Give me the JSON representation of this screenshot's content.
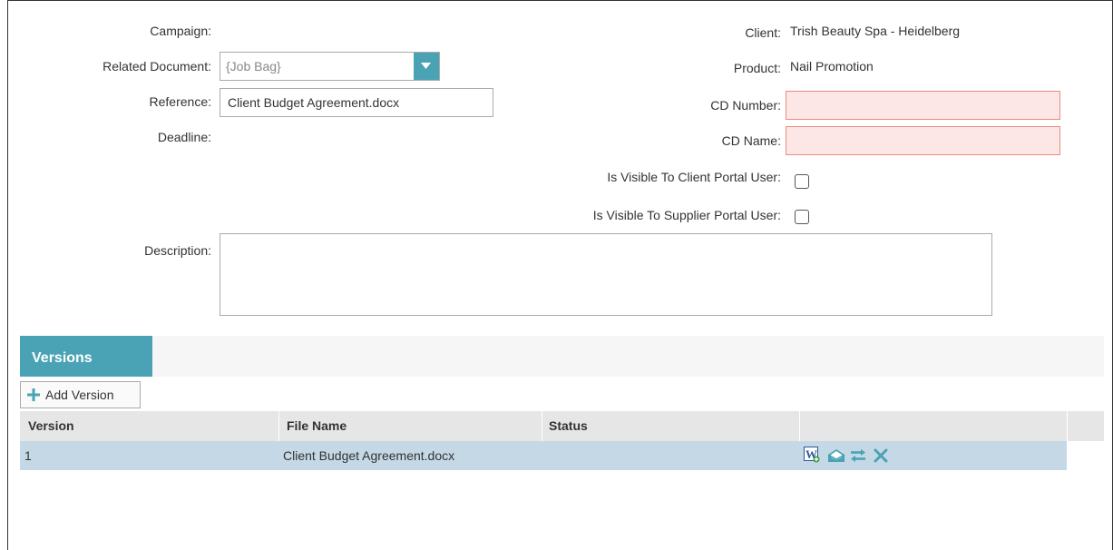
{
  "form": {
    "campaign_label": "Campaign:",
    "related_document_label": "Related Document:",
    "related_document_value": "{Job Bag}",
    "reference_label": "Reference:",
    "reference_value": "Client Budget Agreement.docx",
    "deadline_label": "Deadline:",
    "description_label": "Description:",
    "description_value": "",
    "client_label": "Client:",
    "client_value": "Trish Beauty Spa - Heidelberg",
    "product_label": "Product:",
    "product_value": "Nail Promotion",
    "cd_number_label": "CD Number:",
    "cd_number_value": "",
    "cd_name_label": "CD Name:",
    "cd_name_value": "",
    "visible_client_label": "Is Visible To Client Portal User:",
    "visible_client_checked": false,
    "visible_supplier_label": "Is Visible To Supplier Portal User:",
    "visible_supplier_checked": false
  },
  "versions": {
    "tab_label": "Versions",
    "add_button_label": "Add Version",
    "columns": [
      "Version",
      "File Name",
      "Status"
    ],
    "rows": [
      {
        "version": "1",
        "file_name": "Client Budget Agreement.docx",
        "status": ""
      }
    ],
    "row_actions": [
      "word-document-icon",
      "open-envelope-icon",
      "swap-arrows-icon",
      "delete-x-icon"
    ]
  },
  "colors": {
    "accent": "#4aa3b5",
    "required_border": "#f08a80",
    "required_fill": "#fde7e6",
    "selected_row": "#c4d8e6",
    "header_row": "#e6e6e6"
  }
}
